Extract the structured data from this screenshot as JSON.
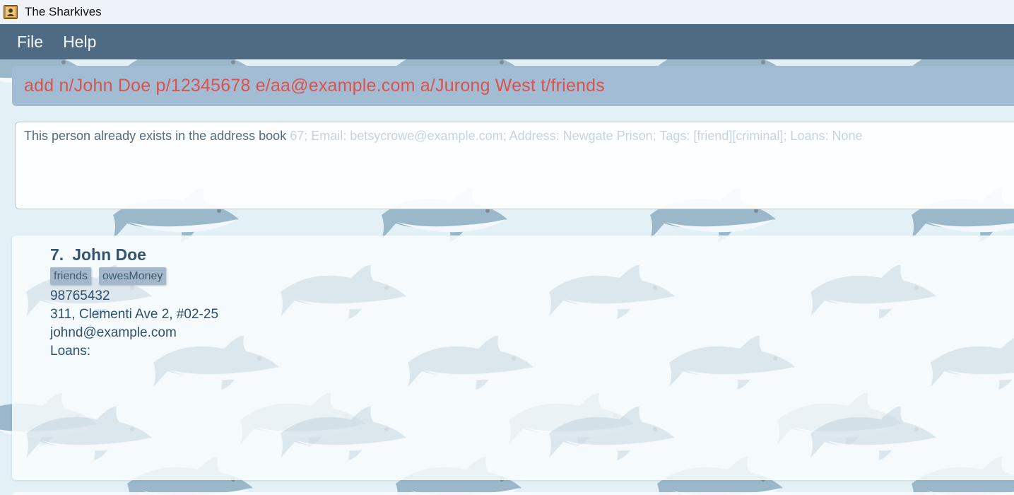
{
  "window": {
    "title": "The Sharkives",
    "app_icon": "contact-book-icon"
  },
  "menu": {
    "items": [
      {
        "label": "File"
      },
      {
        "label": "Help"
      }
    ]
  },
  "command_box": {
    "value": "add n/John Doe p/12345678 e/aa@example.com a/Jurong West t/friends",
    "text_color": "#d9534f"
  },
  "result_display": {
    "ghost_text": "This person already exists in the address book 67; Email: betsycrowe@example.com; Address: Newgate Prison; Tags: [friend][criminal]; Loans: None",
    "message": "This person already exists in the address book"
  },
  "person_list": {
    "cards": [
      {
        "index": "7.",
        "name": "John Doe",
        "tags": [
          "friends",
          "owesMoney"
        ],
        "phone": "98765432",
        "address": "311, Clementi Ave 2, #02-25",
        "email": "johnd@example.com",
        "loans": "Loans:"
      }
    ]
  },
  "colors": {
    "menu_bar": "#4f6b83",
    "command_bg": "#a2bdd3",
    "tag_bg": "#a5b8c9"
  }
}
